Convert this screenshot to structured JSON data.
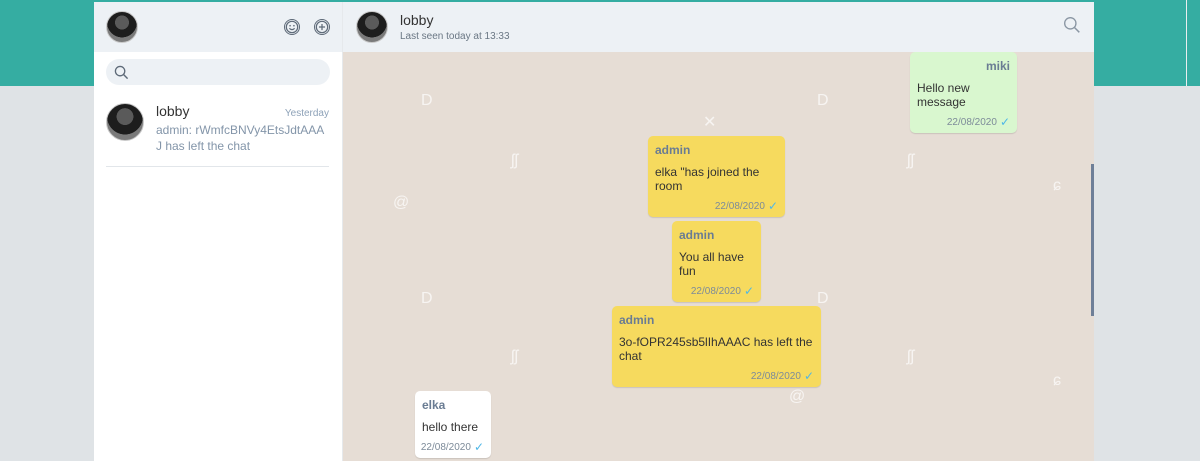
{
  "sidebar": {
    "search": {
      "placeholder": "",
      "value": ""
    },
    "chats": [
      {
        "name": "lobby",
        "time": "Yesterday",
        "preview": "admin: rWmfcBNVy4EtsJdtAAAJ has left the chat"
      }
    ]
  },
  "header": {
    "title": "lobby",
    "subtitle": "Last seen today at 13:33"
  },
  "messages": [
    {
      "author": "miki",
      "text": "Hello new message",
      "time": "22/08/2020",
      "kind": "me"
    },
    {
      "author": "admin",
      "text": "elka \"has joined the room",
      "time": "22/08/2020",
      "kind": "admin"
    },
    {
      "author": "admin",
      "text": "You all have fun",
      "time": "22/08/2020",
      "kind": "admin"
    },
    {
      "author": "admin",
      "text": "3o-fOPR245sb5lIhAAAC has left the chat",
      "time": "22/08/2020",
      "kind": "admin"
    },
    {
      "author": "elka",
      "text": "hello there",
      "time": "22/08/2020",
      "kind": "other"
    }
  ],
  "icons": {
    "check": "check-icon",
    "emoji": "smiley-icon",
    "add": "plus-circle-icon",
    "search": "search-icon"
  },
  "colors": {
    "teal": "#35ada2",
    "own_bubble": "#d9f7cf",
    "admin_bubble": "#f6da5e",
    "chat_bg": "#e6ddd5"
  }
}
